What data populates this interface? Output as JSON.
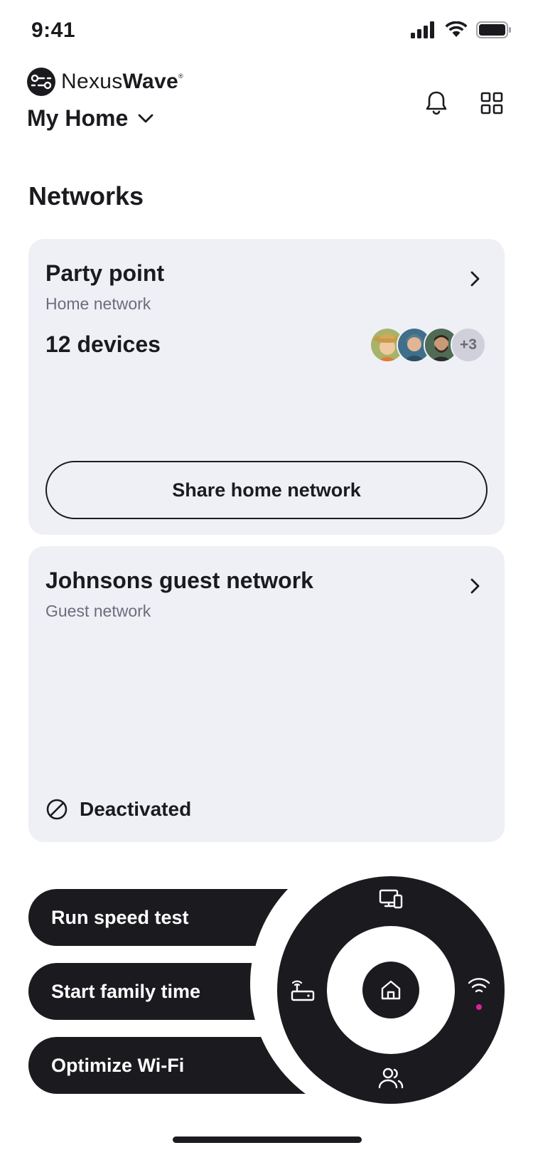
{
  "status_bar": {
    "time": "9:41"
  },
  "header": {
    "brand_light": "Nexus",
    "brand_bold": "Wave",
    "brand_mark": "®",
    "home_selector": "My Home",
    "icons": [
      "bell-icon",
      "grid-icon"
    ]
  },
  "section": {
    "title": "Networks"
  },
  "networks": [
    {
      "name": "Party point",
      "type": "Home network",
      "devices": "12 devices",
      "avatars_extra": "+3",
      "share_label": "Share home network"
    },
    {
      "name": "Johnsons guest network",
      "type": "Guest network",
      "status": "Deactivated"
    }
  ],
  "actions": [
    "Run speed test",
    "Start family time",
    "Optimize Wi-Fi"
  ],
  "dial": {
    "items": [
      "devices-icon",
      "router-icon",
      "home-icon",
      "wifi-icon",
      "people-icon"
    ],
    "accent": "#e0219a"
  },
  "colors": {
    "dark": "#1b1b1f",
    "card_bg": "#eff0f6",
    "muted": "#6b6d7b"
  }
}
